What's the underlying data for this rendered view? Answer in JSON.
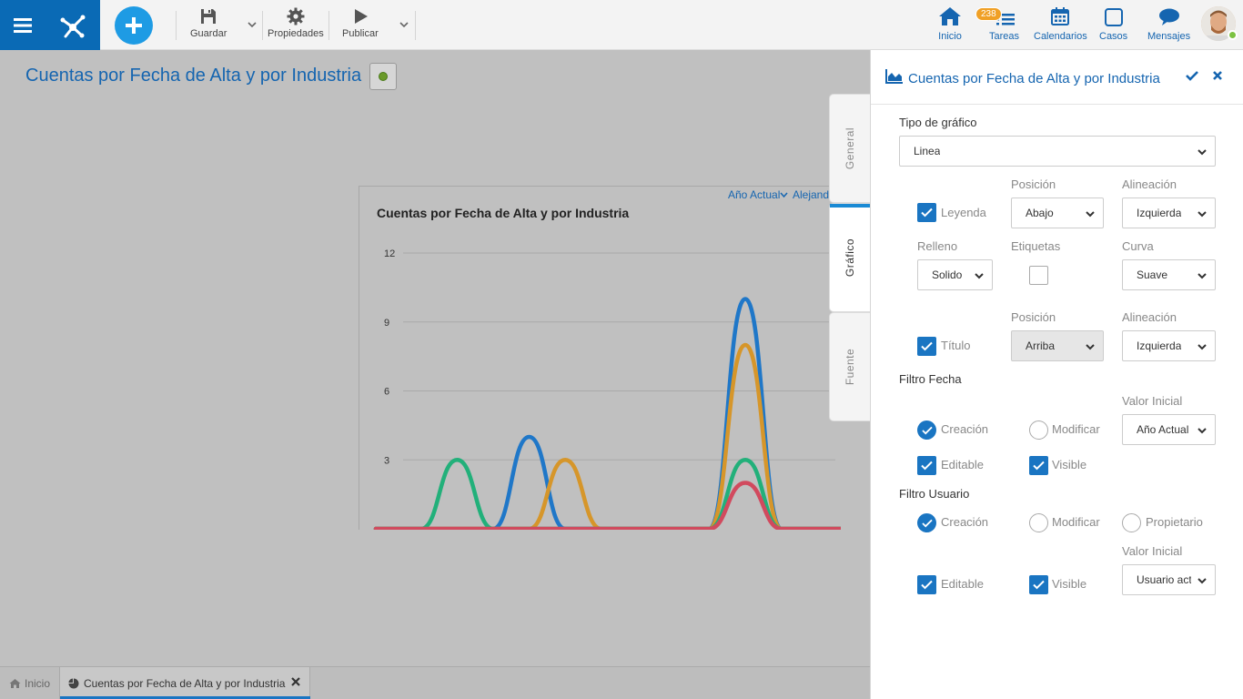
{
  "toolbar": {
    "save_label": "Guardar",
    "properties_label": "Propiedades",
    "publish_label": "Publicar"
  },
  "nav": {
    "home": "Inicio",
    "tasks": "Tareas",
    "tasks_badge": "238",
    "calendars": "Calendarios",
    "cases": "Casos",
    "messages": "Mensajes"
  },
  "page": {
    "title": "Cuentas por Fecha de Alta y por Industria"
  },
  "chart_filters": {
    "date": "Año Actual",
    "user": "Alejandro"
  },
  "chart_data": {
    "type": "line",
    "title": "Cuentas por Fecha de Alta y por Industria",
    "xlabel": "",
    "ylabel": "",
    "ylim": [
      0,
      12
    ],
    "yticks": [
      3,
      6,
      9,
      12
    ],
    "curve": "smooth",
    "points": 12,
    "series": [
      {
        "color": "#1f77c8",
        "values": [
          0,
          0,
          0,
          4,
          0,
          0,
          0,
          0,
          0,
          10,
          0,
          0
        ]
      },
      {
        "color": "#d6962a",
        "values": [
          0,
          0,
          0,
          0,
          3,
          0,
          0,
          0,
          0,
          8,
          0,
          0
        ]
      },
      {
        "color": "#22b07a",
        "values": [
          0,
          3,
          0,
          0,
          0,
          0,
          0,
          0,
          0,
          3,
          0,
          0
        ]
      },
      {
        "color": "#d14a5e",
        "values": [
          0,
          0,
          0,
          0,
          0,
          0,
          0,
          0,
          0,
          2,
          0,
          0
        ]
      }
    ]
  },
  "tabs": {
    "general": "General",
    "chart": "Gráfico",
    "source": "Fuente"
  },
  "panel": {
    "title": "Cuentas por Fecha de Alta y por Industria",
    "chart_type_label": "Tipo de gráfico",
    "chart_type_value": "Linea",
    "position_label": "Posición",
    "alignment_label": "Alineación",
    "legend_label": "Leyenda",
    "legend_position": "Abajo",
    "legend_alignment": "Izquierda",
    "fill_label": "Relleno",
    "labels_label": "Etiquetas",
    "curve_label": "Curva",
    "fill_value": "Solido",
    "curve_value": "Suave",
    "title_label": "Título",
    "title_position": "Arriba",
    "title_alignment": "Izquierda",
    "date_filter_label": "Filtro Fecha",
    "initial_value_label": "Valor Inicial",
    "date_creation": "Creación",
    "date_modify": "Modificar",
    "date_initial_value": "Año Actual",
    "date_editable": "Editable",
    "date_visible": "Visible",
    "user_filter_label": "Filtro Usuario",
    "user_creation": "Creación",
    "user_modify": "Modificar",
    "user_owner": "Propietario",
    "user_initial_value": "Usuario actual",
    "user_editable": "Editable",
    "user_visible": "Visible"
  },
  "bottom_tabs": {
    "home": "Inicio",
    "doc": "Cuentas por Fecha de Alta y por Industria"
  }
}
